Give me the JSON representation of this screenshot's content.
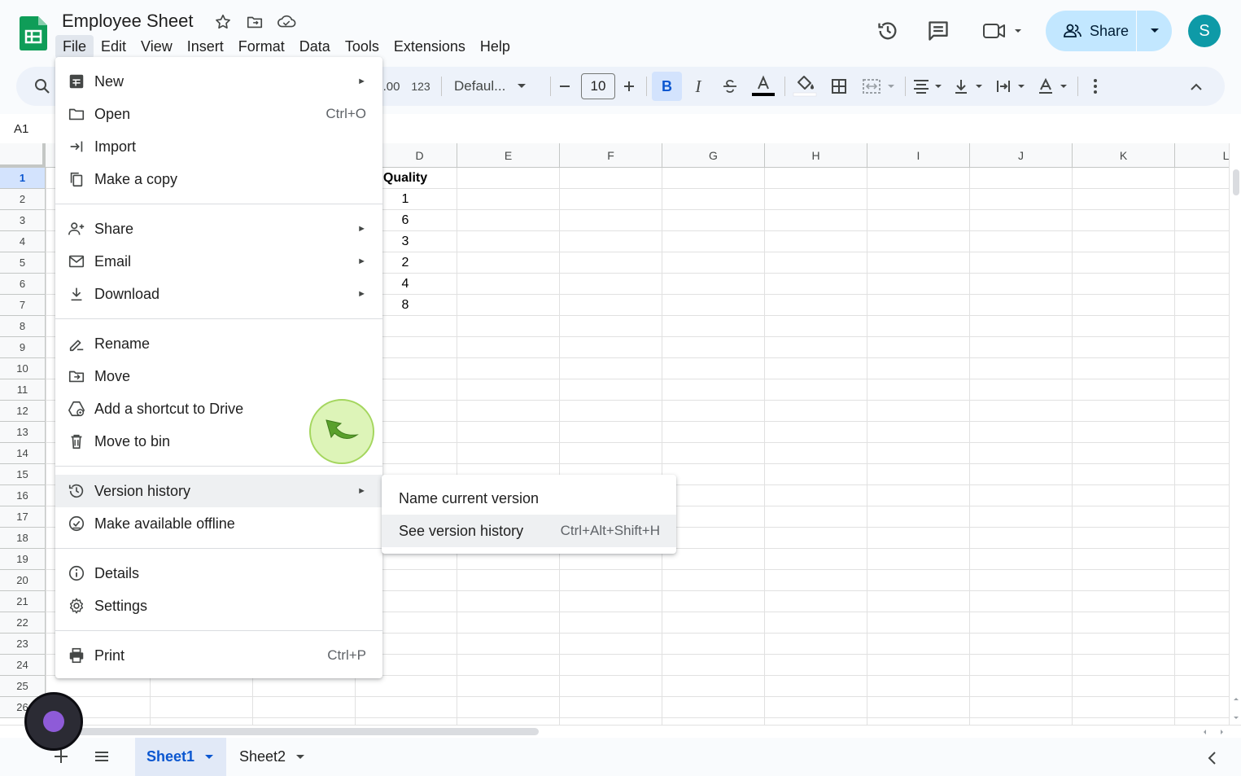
{
  "header": {
    "title": "Employee Sheet",
    "menu": [
      "File",
      "Edit",
      "View",
      "Insert",
      "Format",
      "Data",
      "Tools",
      "Extensions",
      "Help"
    ],
    "active_menu": "File",
    "share_label": "Share",
    "avatar_letter": "S"
  },
  "toolbar": {
    "format_number": "123",
    "font": "Defaul...",
    "font_size": "10",
    "bold": "B",
    "italic": "I"
  },
  "name_box": "A1",
  "grid": {
    "columns": [
      "D",
      "E",
      "F",
      "G",
      "H",
      "I",
      "J",
      "K",
      "L"
    ],
    "rows": [
      "1",
      "2",
      "3",
      "4",
      "5",
      "6",
      "7",
      "8",
      "9",
      "10",
      "11",
      "12",
      "13",
      "14",
      "15",
      "16",
      "17",
      "18",
      "19",
      "20",
      "21",
      "22",
      "23",
      "24",
      "25",
      "26"
    ],
    "selected_row": "1",
    "column_d": {
      "header": "Quality",
      "values": [
        "1",
        "6",
        "3",
        "2",
        "4",
        "8"
      ]
    }
  },
  "file_menu": {
    "items": [
      {
        "label": "New",
        "icon": "new-sheet-icon",
        "arrow": true
      },
      {
        "label": "Open",
        "icon": "folder-icon",
        "shortcut": "Ctrl+O"
      },
      {
        "label": "Import",
        "icon": "import-icon"
      },
      {
        "label": "Make a copy",
        "icon": "copy-icon"
      },
      {
        "label": "Share",
        "icon": "person-add-icon",
        "arrow": true
      },
      {
        "label": "Email",
        "icon": "email-icon",
        "arrow": true
      },
      {
        "label": "Download",
        "icon": "download-icon",
        "arrow": true
      },
      {
        "label": "Rename",
        "icon": "rename-icon"
      },
      {
        "label": "Move",
        "icon": "move-icon"
      },
      {
        "label": "Add a shortcut to Drive",
        "icon": "drive-shortcut-icon"
      },
      {
        "label": "Move to bin",
        "icon": "trash-icon"
      },
      {
        "label": "Version history",
        "icon": "history-icon",
        "arrow": true
      },
      {
        "label": "Make available offline",
        "icon": "offline-icon"
      },
      {
        "label": "Details",
        "icon": "info-icon"
      },
      {
        "label": "Settings",
        "icon": "gear-icon"
      },
      {
        "label": "Print",
        "icon": "print-icon",
        "shortcut": "Ctrl+P"
      }
    ],
    "arrow_glyph": "►"
  },
  "version_submenu": {
    "items": [
      {
        "label": "Name current version"
      },
      {
        "label": "See version history",
        "shortcut": "Ctrl+Alt+Shift+H"
      }
    ]
  },
  "sheets": {
    "tabs": [
      "Sheet1",
      "Sheet2"
    ],
    "active": "Sheet1"
  },
  "colors": {
    "accent": "#0b57d0",
    "share_bg": "#c2e7ff",
    "avatar_bg": "#0e9aa7",
    "sheets_green": "#0f9d58"
  }
}
